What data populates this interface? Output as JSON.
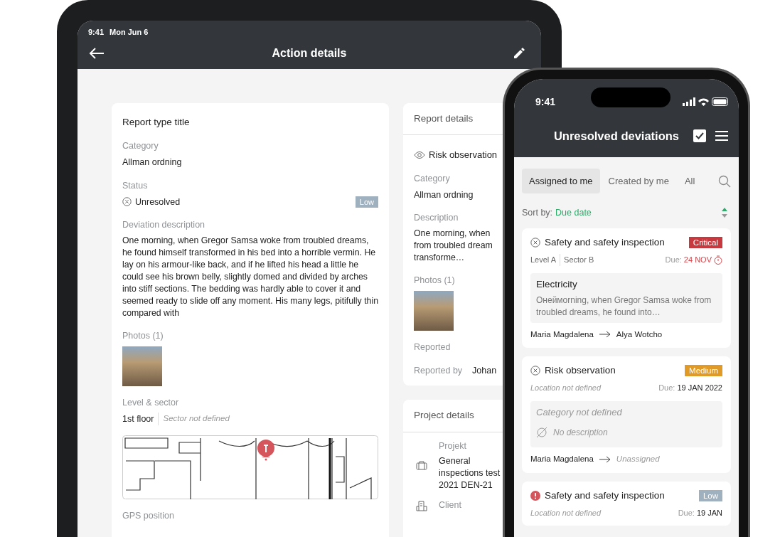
{
  "tablet": {
    "status_time": "9:41",
    "status_date": "Mon Jun 6",
    "title": "Action details",
    "report": {
      "title": "Report type title",
      "category_label": "Category",
      "category": "Allman ordning",
      "status_label": "Status",
      "status": "Unresolved",
      "priority": {
        "label": "Low",
        "color": "#9fb1bf"
      },
      "description_label": "Deviation description",
      "description": "One morning, when Gregor Samsa woke from troubled dreams, he found himself transformed in his bed into a horrible vermin. He lay on his armour-like back, and if he lifted his head a little he could see his brown belly, slightly domed and divided by arches into stiff sections. The bedding was hardly able to cover it and seemed ready to slide off any moment. His many legs, pitifully thin compared with",
      "photos_label": "Photos (1)",
      "level_label": "Level & sector",
      "level": "1st floor",
      "sector": "Sector not defined",
      "gps_label": "GPS position"
    },
    "report_details": {
      "heading": "Report details",
      "type": "Risk observation",
      "category_label": "Category",
      "category": "Allman ordning",
      "description_label": "Description",
      "description_lines": [
        "One morning, when",
        "from troubled dream",
        "transforme…"
      ],
      "photos_label": "Photos (1)",
      "reported_label": "Reported",
      "reported_by_label": "Reported by",
      "reported_by": "Johan"
    },
    "project_details": {
      "heading": "Project details",
      "fields": [
        {
          "kind": "project",
          "label": "Projekt",
          "value": "General inspections test 2021 DEN-21"
        },
        {
          "kind": "client",
          "label": "Client"
        }
      ]
    }
  },
  "phone": {
    "time": "9:41",
    "title": "Unresolved deviations",
    "filters": [
      {
        "label": "Assigned to me",
        "selected": true
      },
      {
        "label": "Created by me",
        "selected": false
      },
      {
        "label": "All",
        "selected": false
      }
    ],
    "sort_label": "Sort by:",
    "sort_value": "Due date",
    "deviations": [
      {
        "kind": "unresolved",
        "title": "Safety and safety inspection",
        "priority": {
          "label": "Critical",
          "color": "#c6393f"
        },
        "location": [
          "Level A",
          "Sector B"
        ],
        "due_label": "Due:",
        "due": "24 NOV",
        "overdue": true,
        "category": "Electricity",
        "category_missing": false,
        "description": "Онеймorning, when Gregor Samsa woke from troubled dreams, he found into…",
        "description_missing": false,
        "from": "Maria Magdalena",
        "to": "Alya Wotcho",
        "assigned": true
      },
      {
        "kind": "unresolved",
        "title": "Risk observation",
        "priority": {
          "label": "Medium",
          "color": "#e09a28"
        },
        "location_note": "Location not defined",
        "due_label": "Due:",
        "due": "19 JAN 2022",
        "overdue": false,
        "category": "Category not defined",
        "category_missing": true,
        "description": "No description",
        "description_missing": true,
        "from": "Maria Magdalena",
        "to": "Unassigned",
        "assigned": false
      },
      {
        "kind": "alert",
        "title": "Safety and safety inspection",
        "priority": {
          "label": "Low",
          "color": "#9fb1bf"
        },
        "location_note": "Location not defined",
        "due_label": "Due:",
        "due": "19 JAN",
        "overdue": false
      }
    ]
  }
}
